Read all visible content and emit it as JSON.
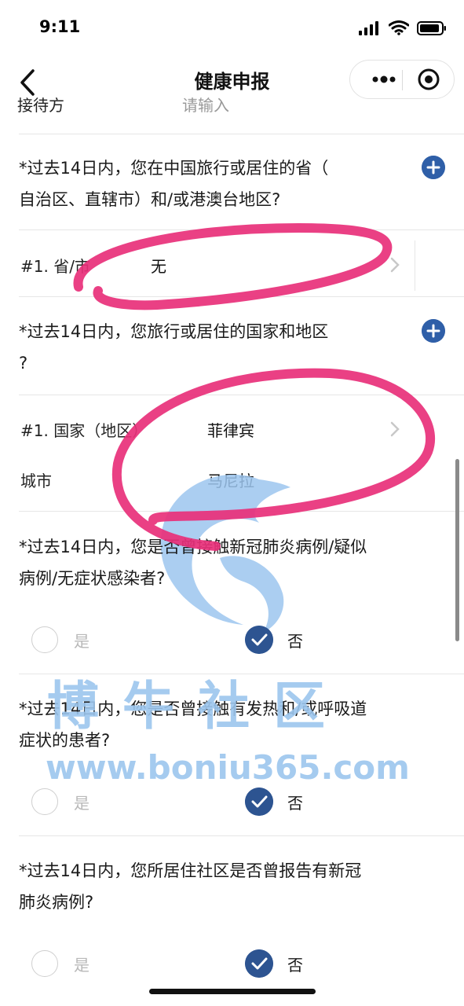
{
  "status_bar": {
    "time": "9:11"
  },
  "nav": {
    "title": "健康申报"
  },
  "cut_off_row": {
    "label": "接待方",
    "value": "请输入"
  },
  "q1": {
    "text_line1": "*过去14日内，您在中国旅行或居住的省（",
    "text_line2": "自治区、直辖市）和/或港澳台地区?",
    "field_label": "#1. 省/市",
    "field_value": "无"
  },
  "q2": {
    "text_line1": "*过去14日内，您旅行或居住的国家和地区",
    "text_line2": "?",
    "country_label": "#1. 国家（地区）",
    "country_value": "菲律宾",
    "city_label": "城市",
    "city_value": "马尼拉"
  },
  "q3": {
    "text_line1": "*过去14日内，您是否曾接触新冠肺炎病例/疑似",
    "text_line2": "病例/无症状感染者?",
    "yes": "是",
    "no": "否"
  },
  "q4": {
    "text_line1": "*过去14日内，您是否曾接触有发热和/或呼吸道",
    "text_line2": "症状的患者?",
    "yes": "是",
    "no": "否"
  },
  "q5": {
    "text_line1": "*过去14日内，您所居住社区是否曾报告有新冠",
    "text_line2": "肺炎病例?",
    "yes": "是",
    "no": "否"
  },
  "watermark": {
    "name": "博牛社区",
    "url": "www.boniu365.com"
  },
  "colors": {
    "accent": "#2f5fa8",
    "annotation": "#e8307a",
    "watermark": "#9cc6ee"
  },
  "icons": [
    "back-arrow-icon",
    "more-icon",
    "close-target-icon",
    "plus-icon",
    "chevron-right-icon",
    "checkmark-icon"
  ]
}
